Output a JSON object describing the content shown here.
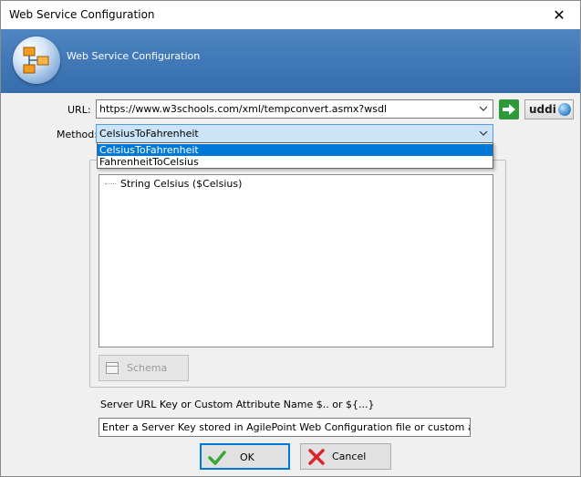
{
  "window": {
    "title": "Web Service Configuration",
    "close_glyph": "✕"
  },
  "banner": {
    "title": "Web Service Configuration",
    "icon": "network-diagram-icon"
  },
  "url": {
    "label": "URL:",
    "value": "https://www.w3schools.com/xml/tempconvert.asmx?wsdl"
  },
  "go_button": {
    "icon": "green-arrow-right-icon"
  },
  "uddi_button": {
    "label": "uddi",
    "icon": "globe-icon"
  },
  "method": {
    "label": "Method:",
    "selected": "CelsiusToFahrenheit",
    "options": [
      "CelsiusToFahrenheit",
      "FahrenheitToCelsius"
    ]
  },
  "tree": {
    "items": [
      "String Celsius ($Celsius)"
    ]
  },
  "schema_button": {
    "label": "Schema"
  },
  "server_key": {
    "label": "Server URL Key or Custom Attribute Name $.. or ${...}",
    "value": "Enter a Server Key stored in AgilePoint Web Configuration file or custom attribute na"
  },
  "buttons": {
    "ok": "OK",
    "cancel": "Cancel"
  },
  "colors": {
    "banner": "#3f77b7",
    "selection": "#0078d7",
    "go_green": "#2d9a3a",
    "cancel_red": "#d9262a"
  }
}
